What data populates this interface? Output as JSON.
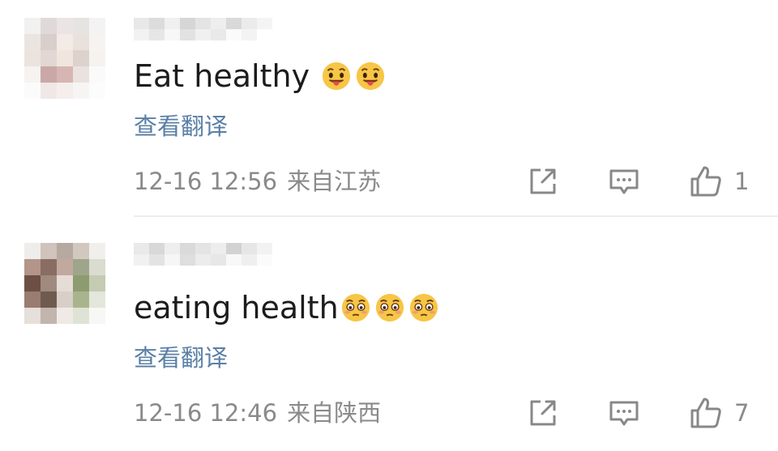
{
  "comments": [
    {
      "text": "Eat healthy",
      "emojis": [
        "tongue-face",
        "tongue-face"
      ],
      "translate_label": "查看翻译",
      "date": "12-16 12:56",
      "location": "来自江苏",
      "like_count": "1",
      "avatar_colors": [
        "#f1f1f1",
        "#e0d9d9",
        "#ece4e4",
        "#e6e4e1",
        "#f3f3f3",
        "#ebe5e1",
        "#d8cfcd",
        "#f3ece6",
        "#e9e1dc",
        "#f6f3f1",
        "#ece3df",
        "#e2d7d2",
        "#f0e6dd",
        "#ddd2cc",
        "#f5f2f0",
        "#f7f3f1",
        "#c9a8a7",
        "#d6b5b3",
        "#eae2df",
        "#fafafa",
        "#fbfbfb",
        "#efe8e6",
        "#f4eeec",
        "#f7f5f4",
        "#fcfcfc"
      ],
      "username_colors": [
        "#e8e8e8",
        "#dcdcdc",
        "#f0f0f0",
        "#d6d6d6",
        "#e4e4e4",
        "#eeeeee",
        "#d9d9d9",
        "#ebebeb",
        "#f4f4f4",
        "#f2f2f2",
        "#e6e6e6",
        "#f7f7f7",
        "#e2e2e2",
        "#f0f0f0",
        "#e9e9e9",
        "#fafafa",
        "#f3f3f3",
        "#ffffff"
      ]
    },
    {
      "text": "eating health",
      "emojis": [
        "flushed-face",
        "flushed-face",
        "flushed-face"
      ],
      "translate_label": "查看翻译",
      "date": "12-16 12:46",
      "location": "来自陕西",
      "like_count": "7",
      "avatar_colors": [
        "#efedeb",
        "#cfc3bc",
        "#b8a9a0",
        "#d1c9c0",
        "#f1efec",
        "#b3958a",
        "#8a6d62",
        "#c2a99f",
        "#9fa58a",
        "#d9dccf",
        "#6e4f45",
        "#a08a80",
        "#e5ddd5",
        "#8c9c6e",
        "#c4cbb2",
        "#9a7c70",
        "#6f5a50",
        "#d8cfc8",
        "#a9b48e",
        "#e3e6da",
        "#e6dfda",
        "#c2b5ad",
        "#efeae6",
        "#dfe3d5",
        "#f7f7f5"
      ],
      "username_colors": [
        "#e9e9e9",
        "#d8d8d8",
        "#eeeeee",
        "#dadada",
        "#e4e4e4",
        "#ededed",
        "#d2d2d2",
        "#e6e6e6",
        "#f2f2f2",
        "#f1f1f1",
        "#e3e3e3",
        "#f6f6f6",
        "#dedede",
        "#ececec",
        "#e7e7e7",
        "#f8f8f8",
        "#efefef",
        "#fbfbfb"
      ]
    }
  ],
  "colors": {
    "text": "#1c1c1c",
    "link": "#5a7fa6",
    "meta": "#8a8a8a",
    "icon": "#888888",
    "divider": "#eeeeee"
  },
  "icons": {
    "share": "share-square-arrow-icon",
    "reply": "comment-bubble-icon",
    "like": "thumbs-up-icon"
  }
}
